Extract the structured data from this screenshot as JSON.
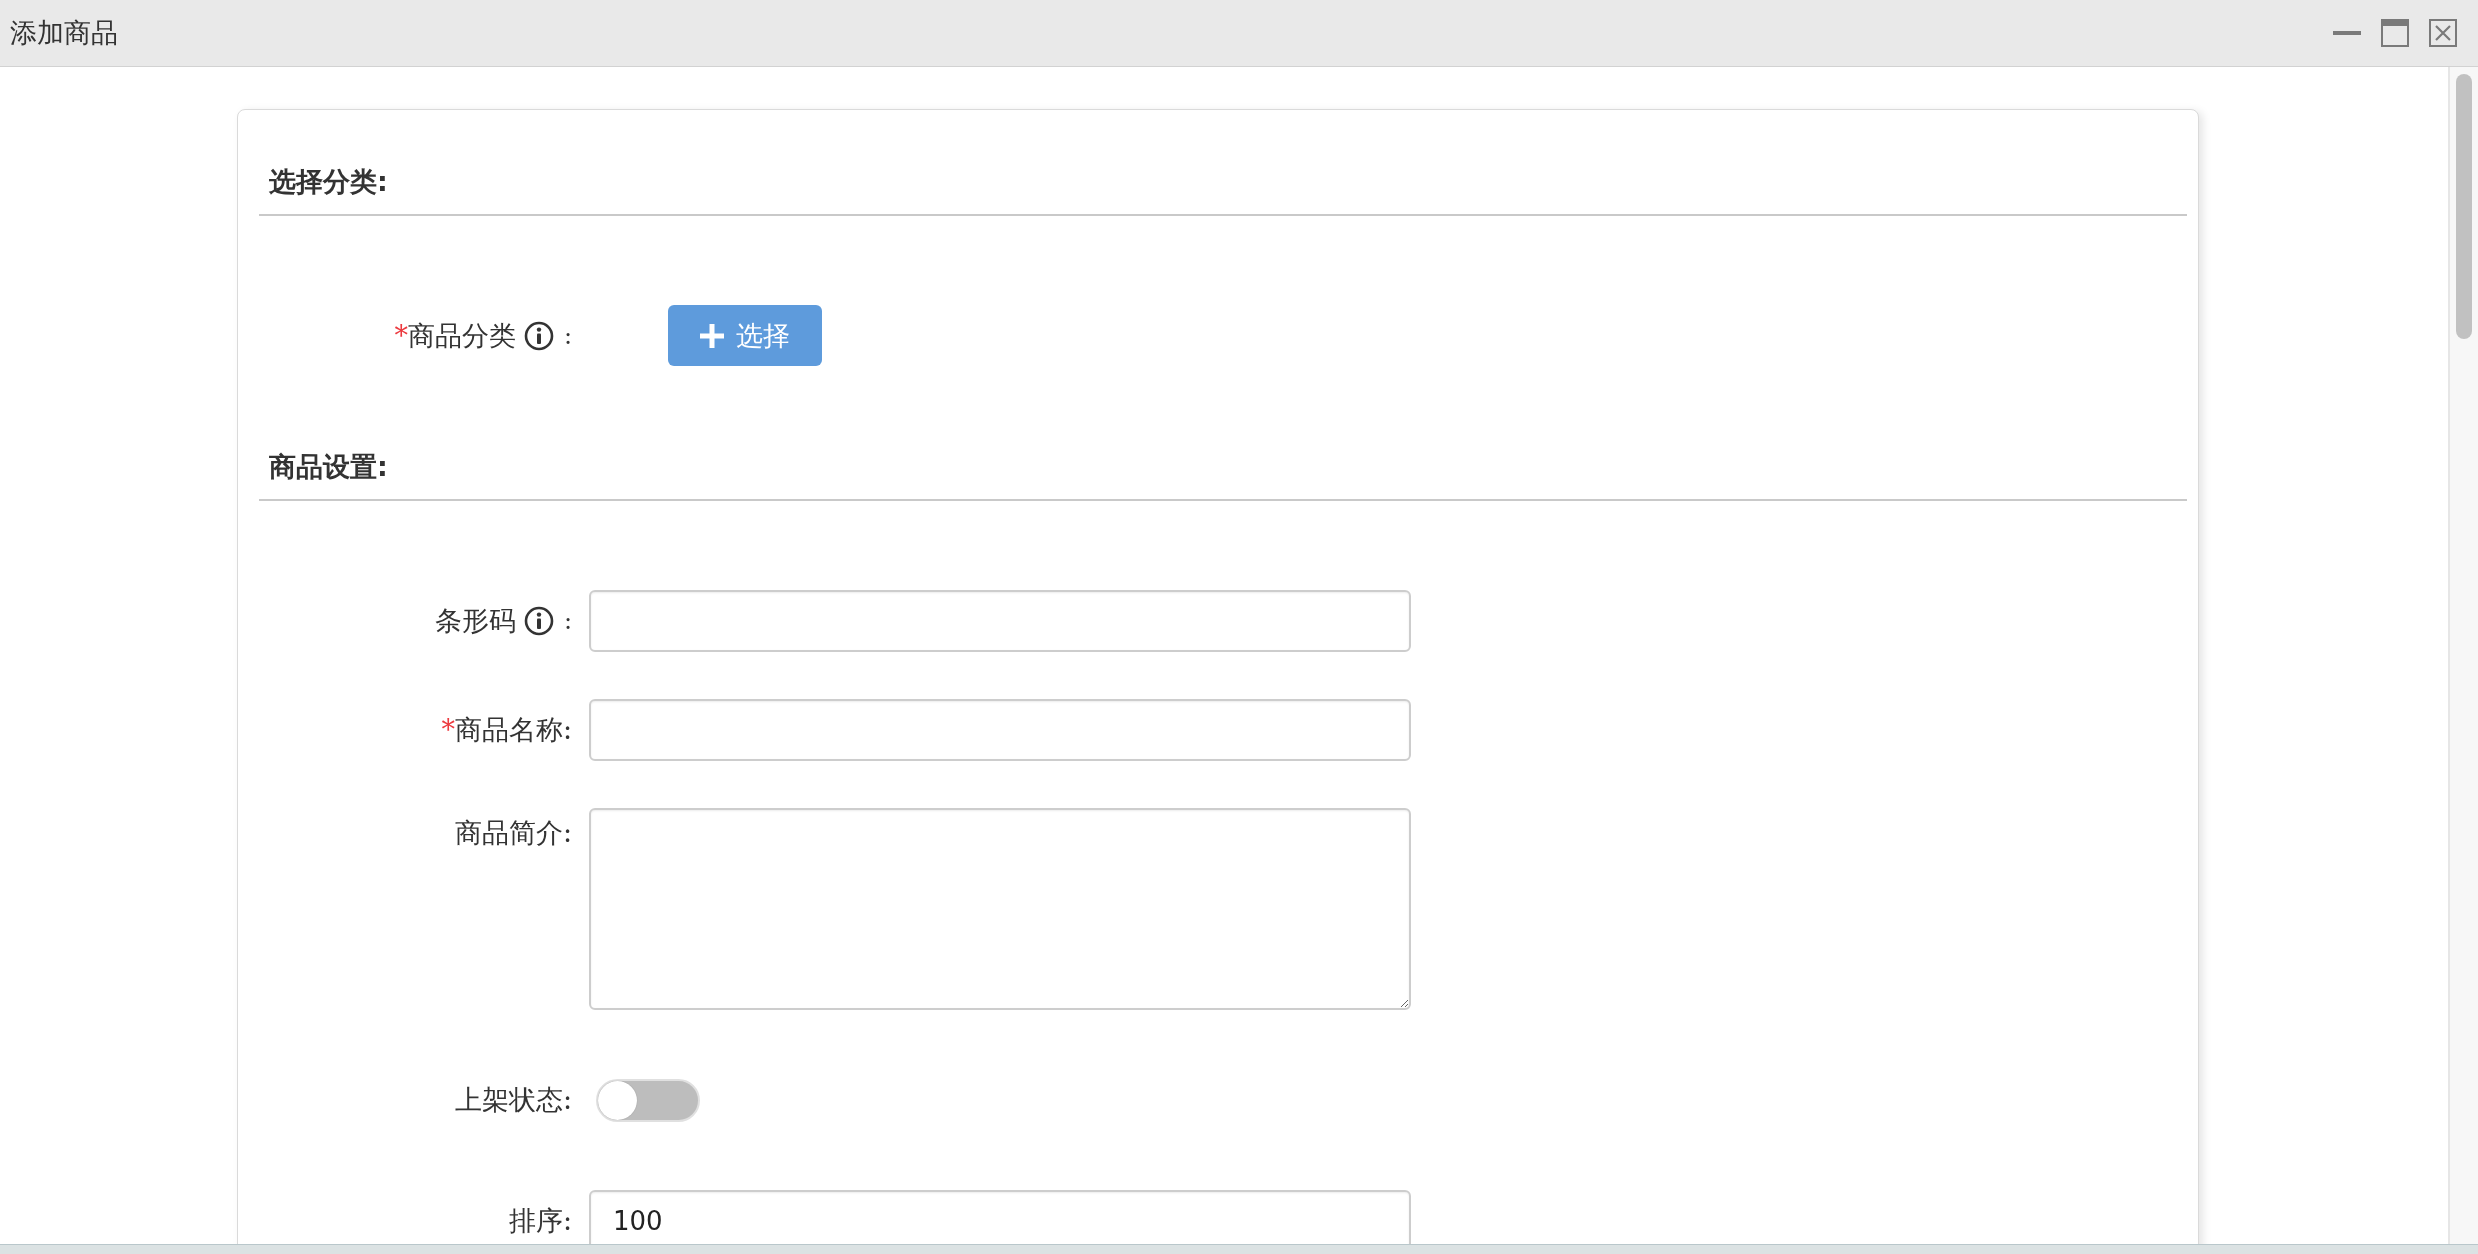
{
  "window": {
    "title": "添加商品"
  },
  "sections": [
    {
      "title": "选择分类:",
      "fields": [
        {
          "kind": "picker",
          "required_mark": "*",
          "label": "商品分类",
          "info": true,
          "suffix": ":",
          "button": "选择"
        }
      ]
    },
    {
      "title": "商品设置:",
      "fields": [
        {
          "kind": "text",
          "label": "条形码",
          "info": true,
          "suffix": ":"
        },
        {
          "kind": "text",
          "required_mark": "*",
          "label": "商品名称:",
          "info": false
        },
        {
          "kind": "textarea",
          "label": "商品简介:",
          "info": false
        },
        {
          "kind": "switch",
          "label": "上架状态:",
          "info": false,
          "on": false
        },
        {
          "kind": "text",
          "label": "排序:",
          "info": false,
          "value": "100"
        }
      ]
    }
  ]
}
